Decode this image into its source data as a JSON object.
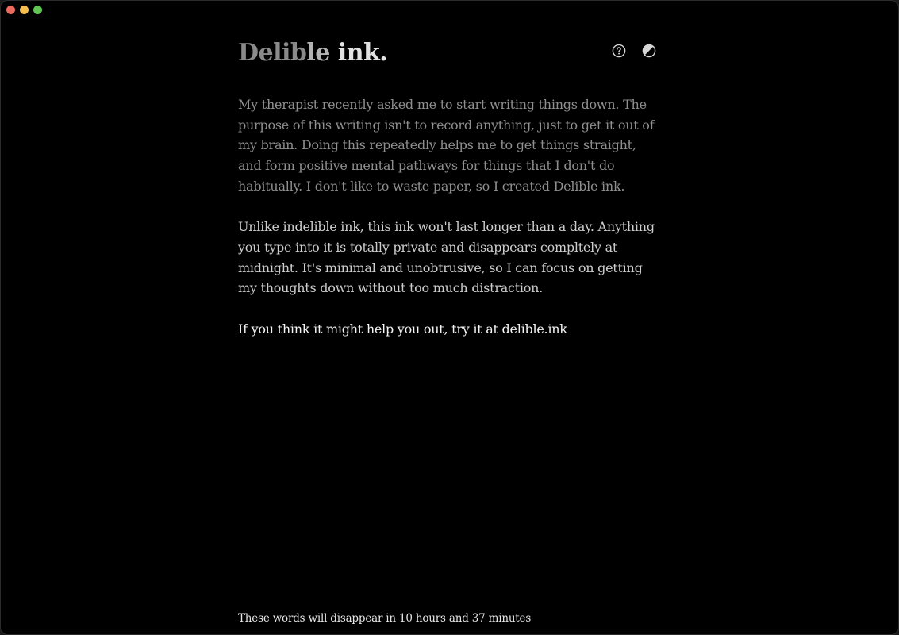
{
  "window": {
    "controls": {
      "close": "close",
      "minimize": "minimize",
      "zoom": "zoom"
    }
  },
  "header": {
    "title_part1": "Delib",
    "title_part2": "le",
    "title_part3": " ink.",
    "help_icon": "help-circle-icon",
    "theme_icon": "theme-toggle-icon"
  },
  "editor": {
    "paragraphs": [
      "My therapist recently asked me to start writing things down. The purpose of this writing isn't to record anything, just to get it out of my brain. Doing this repeatedly helps me to get things straight, and form positive mental pathways for things that I don't do habitually. I don't like to waste paper, so I created Delible ink.",
      "Unlike indelible ink, this ink won't last longer than a day. Anything you type into it is totally private and disappears compltely at midnight. It's minimal and unobtrusive, so I can focus on getting my thoughts down without too much distraction.",
      "If you think it might help you out, try it at delible.ink"
    ]
  },
  "footer": {
    "countdown": "These words will disappear in 10 hours and 37 minutes"
  },
  "colors": {
    "background": "#000000",
    "text_faded": "#8f8f8f",
    "text_mid": "#cdcdcd",
    "text_bright": "#f4f4f4"
  }
}
